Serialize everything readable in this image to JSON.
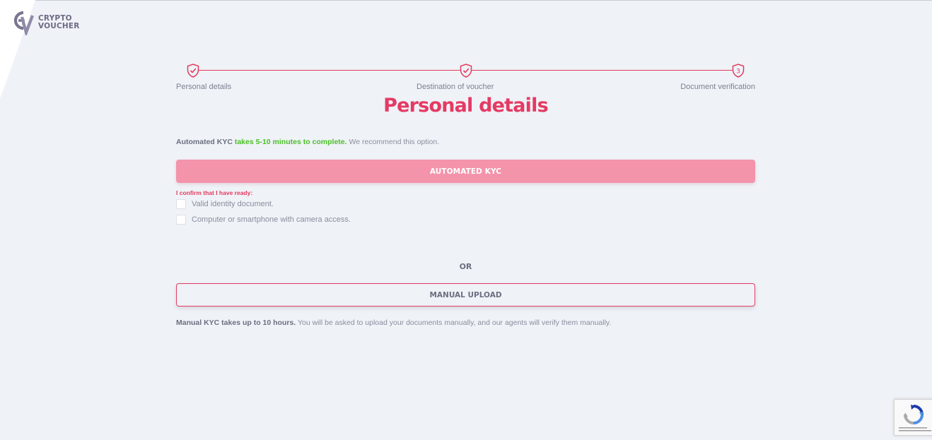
{
  "logo": {
    "line1": "CRYPTO",
    "line2": "VOUCHER",
    "brand_color": "#6e6a85"
  },
  "stepper": {
    "accent": "#e23b5f",
    "steps": [
      {
        "label": "Personal details",
        "state": "done",
        "icon": "shield-check-icon"
      },
      {
        "label": "Destination of voucher",
        "state": "done",
        "icon": "shield-check-icon"
      },
      {
        "label": "Document verification",
        "state": "current",
        "number": "3",
        "icon": "shield-number-icon"
      }
    ]
  },
  "page": {
    "title": "Personal details",
    "title_color": "#e53a63"
  },
  "automated": {
    "intro_bold": "Automated KYC",
    "intro_green": "takes 5-10 minutes to complete.",
    "intro_rest": "We recommend this option.",
    "button_label": "AUTOMATED KYC",
    "button_color": "#f394ab",
    "confirm_label": "I confirm that I have ready:",
    "checklist": [
      {
        "label": "Valid identity document.",
        "checked": false
      },
      {
        "label": "Computer or smartphone with camera access.",
        "checked": false
      }
    ]
  },
  "divider": {
    "or_label": "OR"
  },
  "manual": {
    "button_label": "MANUAL UPLOAD",
    "note_bold": "Manual KYC takes up to 10 hours.",
    "note_rest": "You will be asked to upload your documents manually, and our agents will verify them manually."
  },
  "recaptcha": {
    "icon": "recaptcha-icon"
  }
}
